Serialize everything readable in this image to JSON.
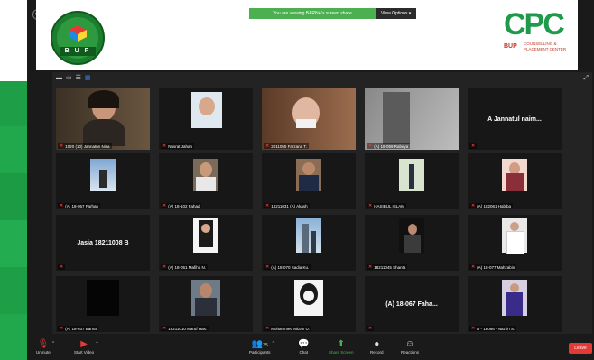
{
  "shared_screen": {
    "banner_message": "You are viewing BARNA's screen share",
    "view_options_label": "View Options",
    "bup_logo_text": "B U P",
    "cpc_logo_text": "CPC",
    "cpc_bup_text": "BUP",
    "cpc_subtitle": "COUNSELLING & PLACEMENT CENTER"
  },
  "gallery": {
    "tiles": [
      {
        "label": "1020 (10) Jannatun Nisa",
        "type": "video-woman"
      },
      {
        "label": "Nusrat Jahan",
        "type": "photo-hijab"
      },
      {
        "label": "2011055 Farzana T.",
        "type": "video-glasses"
      },
      {
        "label": "(A) 18-059 Rabeya",
        "type": "video-blur"
      },
      {
        "label": "",
        "big_name": "A Jannatul naim...",
        "type": "name"
      },
      {
        "label": "(A) 18-057 Farhan",
        "type": "photo-mountain"
      },
      {
        "label": "(A) 18-102 Fahad",
        "type": "photo-man"
      },
      {
        "label": "18211031 (A) Akash",
        "type": "photo-suit"
      },
      {
        "label": "HASIBUL ISLAM",
        "type": "photo-stand"
      },
      {
        "label": "(A) 182061 Habiba",
        "type": "photo-girl"
      },
      {
        "label": "",
        "big_name": "Jasia 18211008 B",
        "type": "name"
      },
      {
        "label": "(A) 18-051 Mafiha N.",
        "type": "photo-hair"
      },
      {
        "label": "(A) 18-070 Sadia Ku.",
        "type": "photo-city"
      },
      {
        "label": "18211045 Shanta",
        "type": "photo-dark"
      },
      {
        "label": "(A) 18-077 Mahzabin",
        "type": "photo-white"
      },
      {
        "label": "(A) 18-037 Barna",
        "type": "black"
      },
      {
        "label": "18211010 Maruf Has.",
        "type": "photo-man2"
      },
      {
        "label": "Mohammed Mizan U.",
        "type": "photo-sketch"
      },
      {
        "label": "",
        "big_name": "(A) 18-067 Faha...",
        "type": "name"
      },
      {
        "label": "B - 18086 - Nazrin S.",
        "type": "photo-saree"
      }
    ]
  },
  "toolbar": {
    "unmute": "Unmute",
    "start_video": "Start Video",
    "participants": "Participants",
    "participants_count": "35",
    "chat": "Chat",
    "share_screen": "Share Screen",
    "record": "Record",
    "reactions": "Reactions",
    "leave": "Leave"
  },
  "colors": {
    "accent_green": "#4caf50",
    "leave_red": "#e53935",
    "mic_muted": "#e53935"
  }
}
